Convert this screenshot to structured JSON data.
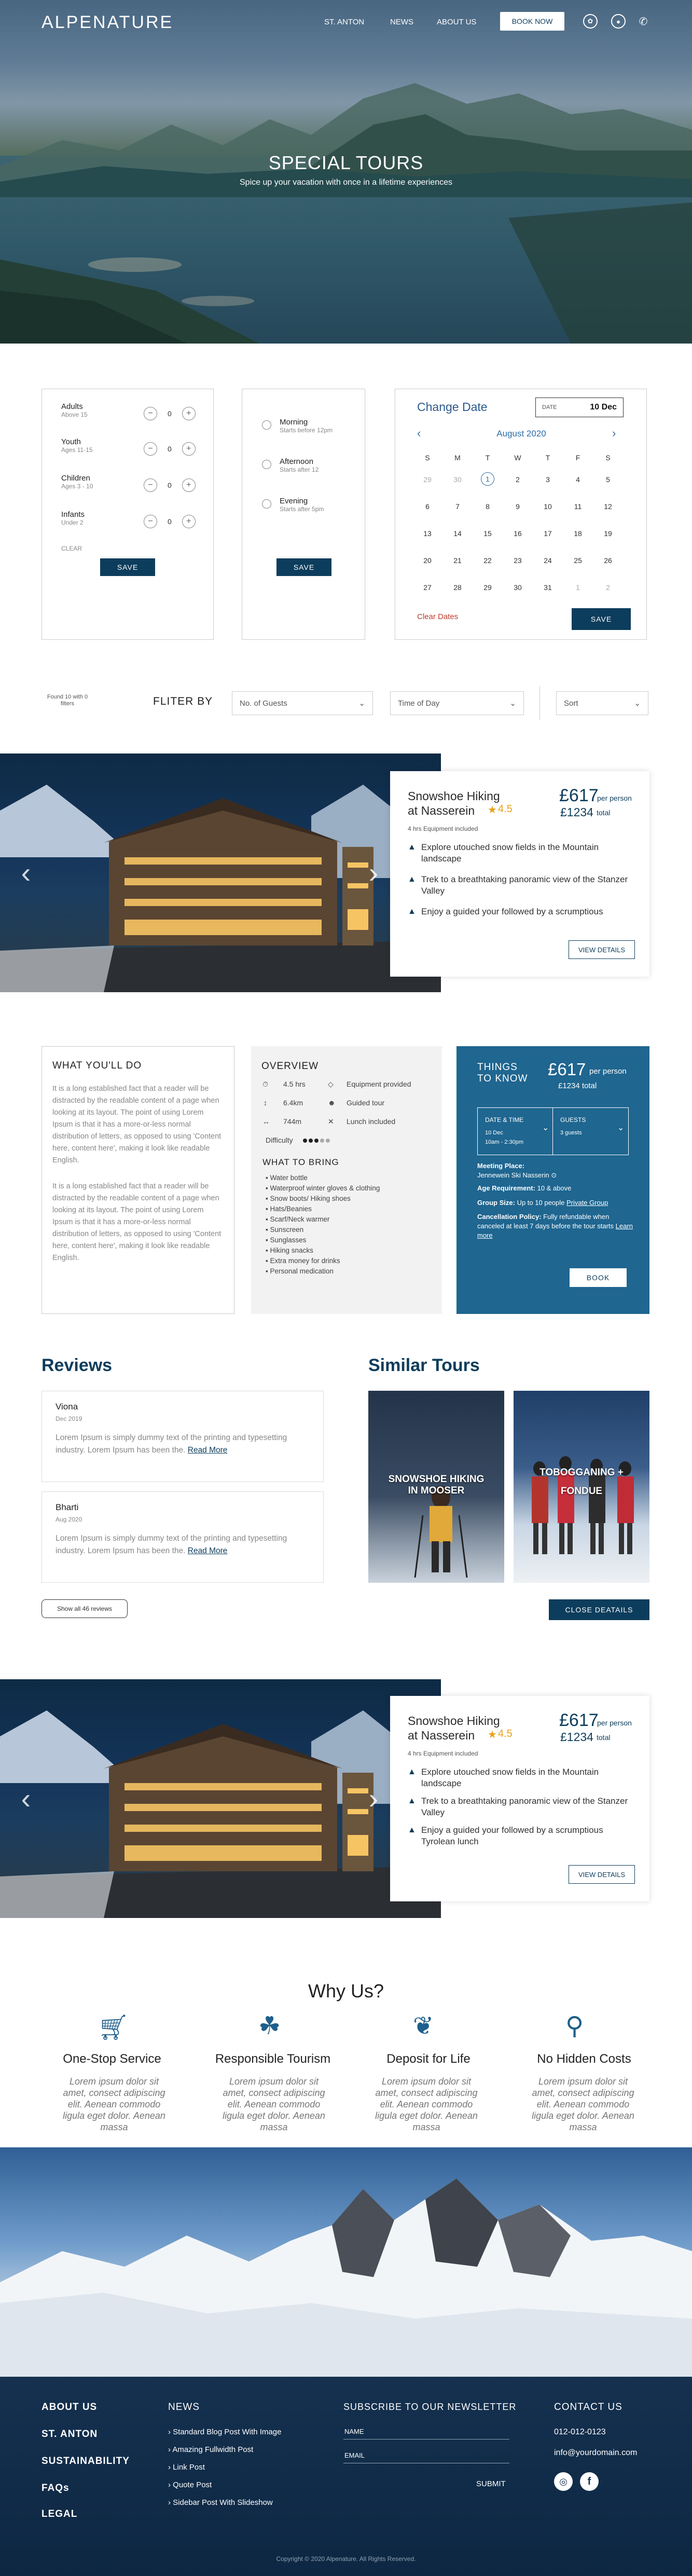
{
  "header": {
    "logo": "ALPENATURE",
    "nav": [
      "ST. ANTON",
      "NEWS",
      "ABOUT US"
    ],
    "book_label": "BOOK NOW",
    "icons": [
      "settings-icon",
      "user-icon",
      "phone-icon"
    ]
  },
  "hero": {
    "title": "SPECIAL TOURS",
    "subtitle": "Spice up your vacation with once in a lifetime experiences"
  },
  "guests": {
    "rows": [
      {
        "label": "Adults",
        "sub": "Above 15",
        "count": "0"
      },
      {
        "label": "Youth",
        "sub": "Ages 11-15",
        "count": "0"
      },
      {
        "label": "Children",
        "sub": "Ages 3 - 10",
        "count": "0"
      },
      {
        "label": "Infants",
        "sub": "Under 2",
        "count": "0"
      }
    ],
    "clear": "CLEAR",
    "save": "SAVE"
  },
  "time": {
    "options": [
      {
        "label": "Morning",
        "sub": "Starts before 12pm"
      },
      {
        "label": "Afternoon",
        "sub": "Starts after 12"
      },
      {
        "label": "Evening",
        "sub": "Starts after 5pm"
      }
    ],
    "save": "SAVE"
  },
  "calendar": {
    "title": "Change Date",
    "date_label": "DATE",
    "date_value": "10 Dec",
    "month": "August 2020",
    "weekdays": [
      "S",
      "M",
      "T",
      "W",
      "T",
      "F",
      "S"
    ],
    "weeks": [
      [
        "29",
        "30",
        "1",
        "2",
        "3",
        "4",
        "5"
      ],
      [
        "6",
        "7",
        "8",
        "9",
        "10",
        "11",
        "12"
      ],
      [
        "13",
        "14",
        "15",
        "16",
        "17",
        "18",
        "19"
      ],
      [
        "20",
        "21",
        "22",
        "23",
        "24",
        "25",
        "26"
      ],
      [
        "27",
        "28",
        "29",
        "30",
        "31",
        "1",
        "2"
      ]
    ],
    "clear": "Clear Dates",
    "save": "SAVE"
  },
  "filter": {
    "found": "Found 10 with 0 filters",
    "label": "FLITER BY",
    "guests": "No. of Guests",
    "time": "Time of Day",
    "sort": "Sort"
  },
  "tour": {
    "title": "Snowshoe Hiking at Nasserein",
    "rating": "4.5",
    "price": "£617",
    "per": "per person",
    "total_price": "£1234",
    "total_label": "total",
    "meta": "4 hrs  Equipment included",
    "bullets": [
      "Explore utouched snow fields in the Mountain landscape",
      "Trek to a breathtaking panoramic view of the Stanzer Valley",
      "Enjoy a guided your followed by a scrumptious"
    ],
    "details": "VIEW DETAILS"
  },
  "tour2": {
    "bullets": [
      "Explore utouched snow fields in the Mountain landscape",
      "Trek to a breathtaking panoramic view of the Stanzer Valley",
      "Enjoy a guided your followed by a scrumptious Tyrolean lunch"
    ]
  },
  "do": {
    "title": "WHAT YOU'LL DO",
    "p1": "It is a long established fact that a reader will be distracted by the readable content of a page when looking at its layout. The point of using Lorem Ipsum is that it has a more-or-less normal distribution of letters, as opposed to using 'Content here, content here', making it look like readable English.",
    "p2": "It is a long established fact that a reader will be distracted by the readable content of a page when looking at its layout. The point of using Lorem Ipsum is that it has a more-or-less normal distribution of letters, as opposed to using 'Content here, content here', making it look like readable English."
  },
  "overview": {
    "title": "OVERVIEW",
    "items": [
      "4.5 hrs",
      "Equipment provided",
      "6.4km",
      "Guided tour",
      "744m",
      "Lunch included"
    ],
    "difficulty": "Difficulty",
    "bring_title": "WHAT TO BRING",
    "bring": [
      "Water bottle",
      "Waterproof winter gloves & clothing",
      "Snow boots/ Hiking shoes",
      "Hats/Beanies",
      "Scarf/Neck warmer",
      "Sunscreen",
      "Sunglasses",
      "Hiking snacks",
      "Extra money for drinks",
      "Personal medication"
    ],
    "difficulty_level": 0.6
  },
  "know": {
    "title": "THINGS TO KNOW",
    "price": "£617",
    "per": "per person",
    "total": "£1234 total",
    "dt_label": "DATE & TIME",
    "dt_value": "10 Dec",
    "dt_time": "10am - 2:30pm",
    "g_label": "GUESTS",
    "g_value": "3 guests",
    "meeting_label": "Meeting Place:",
    "meeting": "Jennewein Ski Nasserin",
    "age_label": "Age Requirement:",
    "age": "10 & above",
    "group_label": "Group Size:",
    "group": "Up to 10 people",
    "group_link": "Private Group",
    "cancel_label": "Cancellation Policy:",
    "cancel": "Fully refundable when canceled at least 7 days before the tour starts",
    "learn": "Learn more",
    "book": "BOOK"
  },
  "reviews": {
    "title": "Reviews",
    "items": [
      {
        "name": "Viona",
        "date": "Dec 2019",
        "text": "Lorem Ipsum is simply dummy text of the printing and typesetting industry. Lorem Ipsum has been the.",
        "more": "Read More"
      },
      {
        "name": "Bharti",
        "date": "Aug 2020",
        "text": "Lorem Ipsum is simply dummy text of the printing and typesetting industry. Lorem Ipsum has been the.",
        "more": "Read More"
      }
    ],
    "show_all": "Show all 46 reviews"
  },
  "similar": {
    "title": "Similar Tours",
    "items": [
      "SNOWSHOE HIKING IN MOOSER",
      "TOBOGGANING + FONDUE"
    ],
    "close": "CLOSE DEATAILS"
  },
  "why": {
    "title": "Why Us?",
    "items": [
      {
        "title": "One-Stop Service",
        "icon": "cart-icon",
        "text": "Lorem ipsum dolor sit amet, consect adipiscing elit. Aenean commodo ligula eget dolor. Aenean massa"
      },
      {
        "title": "Responsible Tourism",
        "icon": "hand-leaf-icon",
        "text": "Lorem ipsum dolor sit amet, consect adipiscing elit. Aenean commodo ligula eget dolor. Aenean massa"
      },
      {
        "title": "Deposit for Life",
        "icon": "leaf-icon",
        "text": "Lorem ipsum dolor sit amet, consect adipiscing elit. Aenean commodo ligula eget dolor. Aenean massa"
      },
      {
        "title": "No Hidden Costs",
        "icon": "search-money-icon",
        "text": "Lorem ipsum dolor sit amet, consect adipiscing elit. Aenean commodo ligula eget dolor. Aenean massa"
      }
    ]
  },
  "footer": {
    "links": [
      "ABOUT US",
      "ST. ANTON",
      "SUSTAINABILITY",
      "FAQs",
      "LEGAL"
    ],
    "news_title": "NEWS",
    "news": [
      "Standard Blog Post With Image",
      "Amazing Fullwidth Post",
      "Link Post",
      "Quote Post",
      "Sidebar Post With Slideshow"
    ],
    "newsletter_title": "SUBSCRIBE TO OUR NEWSLETTER",
    "name": "NAME",
    "email": "EMAIL",
    "submit": "SUBMIT",
    "contact_title": "CONTACT US",
    "phone": "012-012-0123",
    "mail": "info@yourdomain.com",
    "copyright": "Copyright © 2020 Alpenature. All Rights Reserved."
  },
  "colors": {
    "navy": "#0d3d5c",
    "blue": "#2d6ea4",
    "panel": "#1f6690",
    "gold": "#e8a317"
  }
}
